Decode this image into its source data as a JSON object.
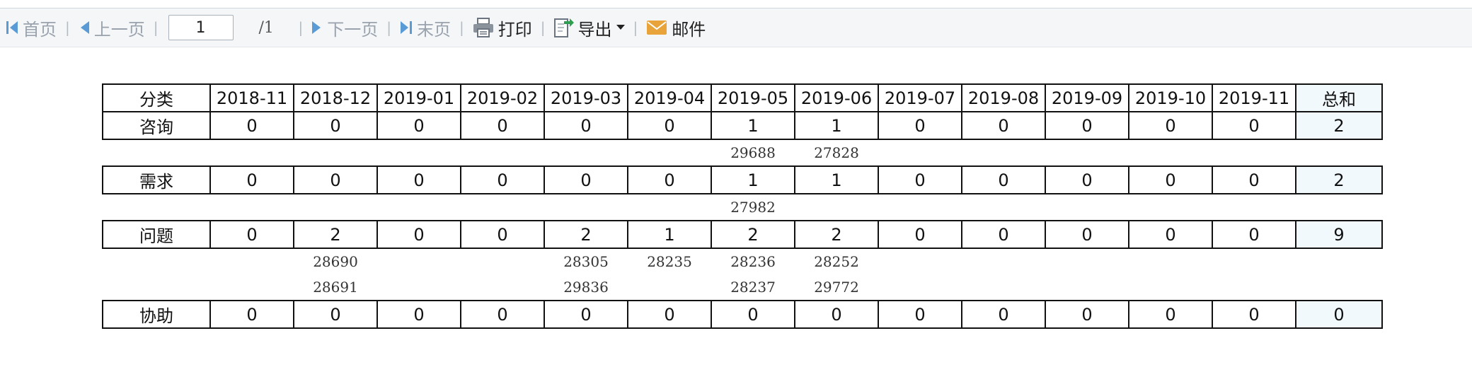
{
  "toolbar": {
    "first": "首页",
    "prev": "上一页",
    "page_value": "1",
    "page_total": "/1",
    "next": "下一页",
    "last": "末页",
    "print": "打印",
    "export": "导出",
    "mail": "邮件",
    "sep": "|",
    "icons": {
      "first": "first-page-icon",
      "prev": "prev-page-icon",
      "next": "next-page-icon",
      "last": "last-page-icon",
      "print": "printer-icon",
      "export": "export-icon",
      "mail": "mail-icon",
      "export_caret": "caret-down-icon"
    },
    "colors": {
      "nav_icon": "#5b9bd5",
      "disabled_text": "#9aa3ad",
      "export_icon": "#2e9e4f",
      "mail_icon": "#e8a33a"
    }
  },
  "table": {
    "header": [
      "分类",
      "2018-11",
      "2018-12",
      "2019-01",
      "2019-02",
      "2019-03",
      "2019-04",
      "2019-05",
      "2019-06",
      "2019-07",
      "2019-08",
      "2019-09",
      "2019-10",
      "2019-11",
      "总和"
    ],
    "rows": [
      {
        "label": "咨询",
        "values": [
          "0",
          "0",
          "0",
          "0",
          "0",
          "0",
          "1",
          "1",
          "0",
          "0",
          "0",
          "0",
          "0"
        ],
        "total": "2",
        "id_rows": [
          [
            "",
            "",
            "",
            "",
            "",
            "",
            "29688",
            "27828",
            "",
            "",
            "",
            "",
            ""
          ]
        ]
      },
      {
        "label": "需求",
        "values": [
          "0",
          "0",
          "0",
          "0",
          "0",
          "0",
          "1",
          "1",
          "0",
          "0",
          "0",
          "0",
          "0"
        ],
        "total": "2",
        "id_rows": [
          [
            "",
            "",
            "",
            "",
            "",
            "",
            "27982",
            "",
            "",
            "",
            "",
            "",
            ""
          ]
        ]
      },
      {
        "label": "问题",
        "values": [
          "0",
          "2",
          "0",
          "0",
          "2",
          "1",
          "2",
          "2",
          "0",
          "0",
          "0",
          "0",
          "0"
        ],
        "total": "9",
        "id_rows": [
          [
            "",
            "28690",
            "",
            "",
            "28305",
            "28235",
            "28236",
            "28252",
            "",
            "",
            "",
            "",
            ""
          ],
          [
            "",
            "28691",
            "",
            "",
            "29836",
            "",
            "28237",
            "29772",
            "",
            "",
            "",
            "",
            ""
          ]
        ]
      },
      {
        "label": "协助",
        "values": [
          "0",
          "0",
          "0",
          "0",
          "0",
          "0",
          "0",
          "0",
          "0",
          "0",
          "0",
          "0",
          "0"
        ],
        "total": "0",
        "id_rows": []
      }
    ],
    "colors": {
      "total_bg": "#f1f9fd",
      "border": "#111111"
    }
  }
}
